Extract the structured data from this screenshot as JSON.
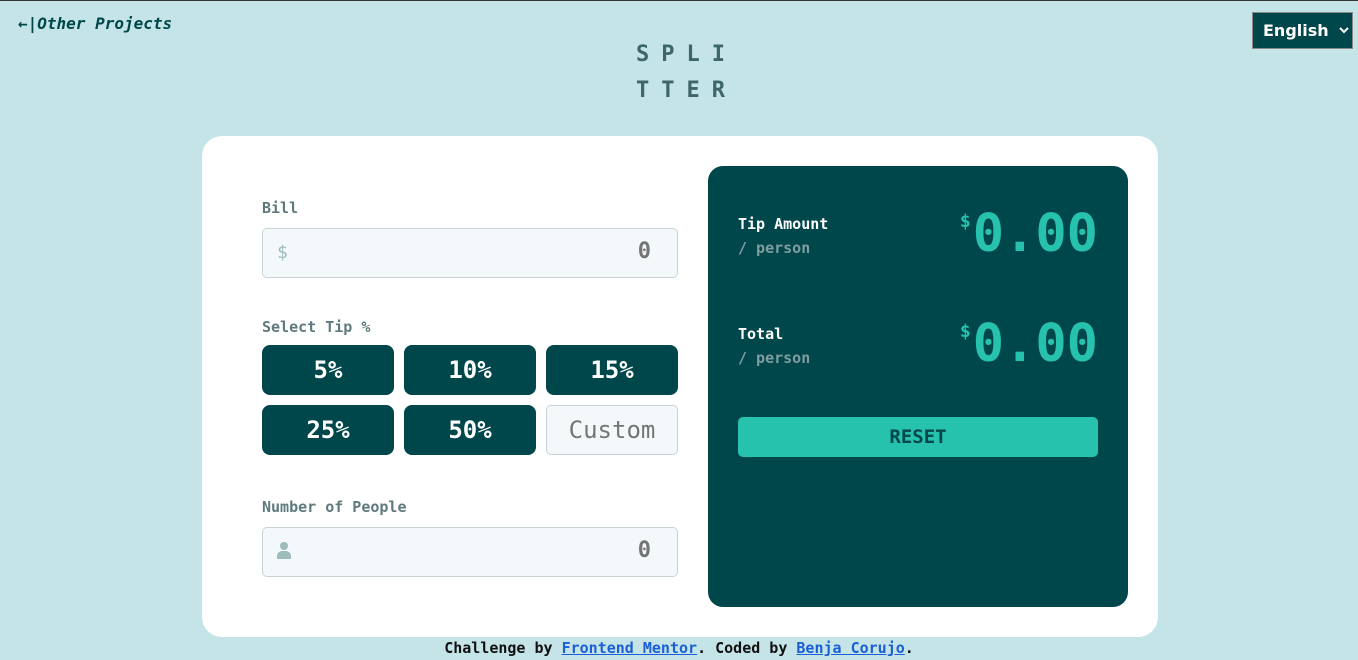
{
  "nav": {
    "back_arrow": "←|",
    "back_label": "Other Projects"
  },
  "language": {
    "selected": "English"
  },
  "logo": {
    "line1": "SPLI",
    "line2": "TTER"
  },
  "form": {
    "bill_label": "Bill",
    "bill_icon": "$",
    "bill_placeholder": "0",
    "tip_label": "Select Tip %",
    "tips": [
      "5%",
      "10%",
      "15%",
      "25%",
      "50%"
    ],
    "custom_placeholder": "Custom",
    "people_label": "Number of People",
    "people_placeholder": "0"
  },
  "results": {
    "tip_label": "Tip Amount",
    "tip_sub": "/ person",
    "tip_currency": "$",
    "tip_value": "0.00",
    "total_label": "Total",
    "total_sub": "/ person",
    "total_currency": "$",
    "total_value": "0.00",
    "reset_label": "RESET"
  },
  "footer": {
    "prefix": "Challenge by ",
    "link1": "Frontend Mentor",
    "middle": ". Coded by ",
    "link2": "Benja Corujo",
    "suffix": "."
  }
}
